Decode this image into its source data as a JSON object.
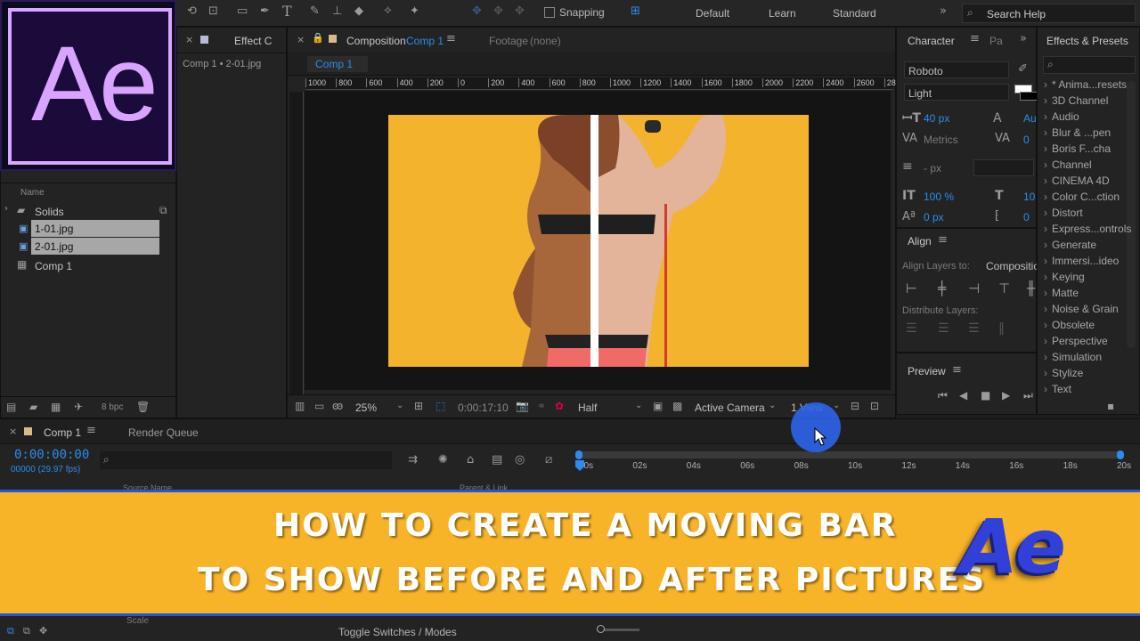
{
  "toolbar": {
    "snapping": "Snapping",
    "workspaces": [
      "Default",
      "Learn",
      "Standard"
    ],
    "search_help": "Search Help"
  },
  "logo_text": "Ae",
  "project": {
    "effect_tab": "Effect C",
    "breadcrumb": "Comp 1 • 2-01.jpg",
    "column_name": "Name",
    "items": [
      "Solids",
      "1-01.jpg",
      "2-01.jpg",
      "Comp 1"
    ],
    "bpc": "8 bpc"
  },
  "composition": {
    "tab_label": "Composition",
    "tab_comp": "Comp 1",
    "footage": "Footage",
    "footage_value": "(none)",
    "comp_tab": "Comp 1",
    "ruler": [
      "1000",
      "800",
      "600",
      "400",
      "200",
      "0",
      "200",
      "400",
      "600",
      "800",
      "1000",
      "1200",
      "1400",
      "1600",
      "1800",
      "2000",
      "2200",
      "2400",
      "2600",
      "2800"
    ],
    "zoom": "25%",
    "timecode": "0:00:17:10",
    "resolution": "Half",
    "camera": "Active Camera",
    "views": "1 View"
  },
  "character": {
    "tab": "Character",
    "tab2": "Pa",
    "font": "Roboto",
    "style": "Light",
    "size": "40 px",
    "metrics": "Metrics",
    "leading": "- px",
    "vscale": "100 %",
    "baseline": "0 px",
    "kern_val": "0",
    "hscale_val": "10",
    "tsume_val": "0",
    "auto_val": "Au"
  },
  "align": {
    "tab": "Align",
    "align_to_label": "Align Layers to:",
    "align_to_value": "Compositio",
    "distribute": "Distribute Layers:"
  },
  "preview": {
    "tab": "Preview"
  },
  "effects": {
    "tab": "Effects & Presets",
    "items": [
      "* Anima...resets",
      "3D Channel",
      "Audio",
      "Blur & ...pen",
      "Boris F...cha",
      "Channel",
      "CINEMA 4D",
      "Color C...ction",
      "Distort",
      "Express...ontrols",
      "Generate",
      "Immersi...ideo",
      "Keying",
      "Matte",
      "Noise & Grain",
      "Obsolete",
      "Perspective",
      "Simulation",
      "Stylize",
      "Text"
    ]
  },
  "timeline": {
    "tab": "Comp 1",
    "render_queue": "Render Queue",
    "timecode": "0:00:00:00",
    "fps": "00000 (29.97 fps)",
    "ticks": [
      "00s",
      "02s",
      "04s",
      "06s",
      "08s",
      "10s",
      "12s",
      "14s",
      "16s",
      "18s",
      "20s"
    ],
    "source_name": "Source Name",
    "parent_link": "Parent & Link",
    "scale": "Scale",
    "toggle": "Toggle Switches / Modes"
  },
  "banner": {
    "line1": "HOW TO CREATE A MOVING BAR",
    "line2": "TO SHOW BEFORE AND AFTER PICTURES",
    "logo3d": "Ae",
    "bg_color": "#f8b428",
    "border_color": "#2457d8"
  }
}
